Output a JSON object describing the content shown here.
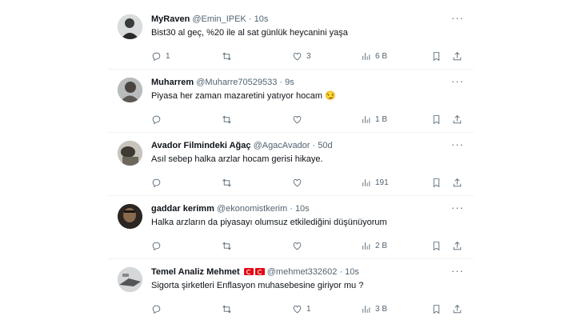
{
  "tweets": [
    {
      "name": "MyRaven",
      "handle": "@Emin_IPEK",
      "time": "10s",
      "text": "Bist30 al geç, %20 ile al sat günlük heycanini yaşa",
      "replies": "1",
      "retweets": "",
      "likes": "3",
      "views": "6 B",
      "flags": false
    },
    {
      "name": "Muharrem",
      "handle": "@Muharre70529533",
      "time": "9s",
      "text": "Piyasa her zaman mazaretini yatıyor hocam 😏",
      "replies": "",
      "retweets": "",
      "likes": "",
      "views": "1 B",
      "flags": false
    },
    {
      "name": "Avador Filmindeki Ağaç",
      "handle": "@AgacAvador",
      "time": "50d",
      "text": "Asıl sebep halka arzlar hocam gerisi hikaye.",
      "replies": "",
      "retweets": "",
      "likes": "",
      "views": "191",
      "flags": false
    },
    {
      "name": "gaddar kerimm",
      "handle": "@ekonomistkerim",
      "time": "10s",
      "text": "Halka arzların da piyasayı olumsuz etkilediğini düşünüyorum",
      "replies": "",
      "retweets": "",
      "likes": "",
      "views": "2 B",
      "flags": false
    },
    {
      "name": "Temel Analiz Mehmet",
      "handle": "@mehmet332602",
      "time": "10s",
      "text": "Sigorta şirketleri Enflasyon muhasebesine giriyor mu ?",
      "replies": "",
      "retweets": "",
      "likes": "1",
      "views": "3 B",
      "flags": true
    }
  ],
  "separator": "·",
  "icons": {
    "reply": "reply-icon",
    "retweet": "retweet-icon",
    "like": "heart-icon",
    "views": "views-icon",
    "bookmark": "bookmark-icon",
    "share": "share-icon",
    "more": "more-icon"
  }
}
